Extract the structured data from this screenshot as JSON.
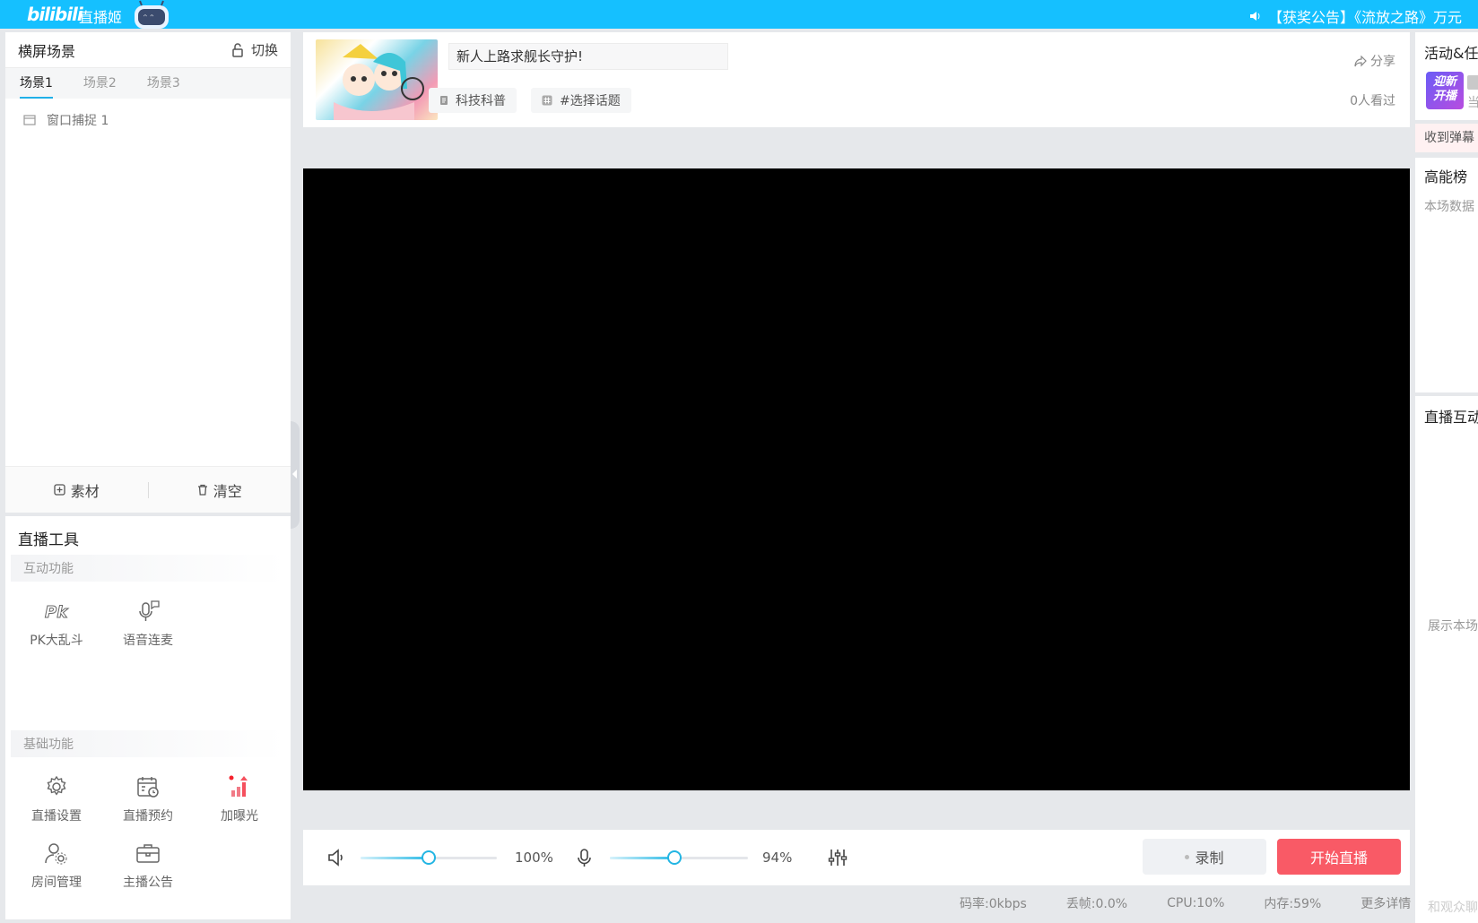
{
  "topbar": {
    "logo": "bilibili",
    "app_name": "直播姬",
    "notice": "【获奖公告】《流放之路》万元"
  },
  "scene_panel": {
    "title": "横屏场景",
    "switch_label": "切换",
    "tabs": [
      {
        "label": "场景1",
        "active": true
      },
      {
        "label": "场景2",
        "active": false
      },
      {
        "label": "场景3",
        "active": false
      }
    ],
    "sources": [
      {
        "label": "窗口捕捉 1"
      }
    ],
    "footer": {
      "add_label": "素材",
      "clear_label": "清空"
    }
  },
  "tools_panel": {
    "title": "直播工具",
    "interactive_section": "互动功能",
    "interactive_tools": [
      {
        "label": "PK大乱斗",
        "icon": "pk-icon"
      },
      {
        "label": "语音连麦",
        "icon": "mic-chat-icon"
      }
    ],
    "basic_section": "基础功能",
    "basic_tools": [
      {
        "label": "直播设置",
        "icon": "gear-icon"
      },
      {
        "label": "直播预约",
        "icon": "calendar-clock-icon"
      },
      {
        "label": "加曝光",
        "icon": "bar-chart-up-icon"
      },
      {
        "label": "房间管理",
        "icon": "user-gear-icon"
      },
      {
        "label": "主播公告",
        "icon": "briefcase-icon"
      }
    ]
  },
  "info_bar": {
    "stream_title": "新人上路求舰长守护!",
    "category": "科技科普",
    "topic": "#选择话题",
    "share_label": "分享",
    "viewers": "0人看过"
  },
  "controls": {
    "speaker_volume": 0.5,
    "speaker_volume_text": "100%",
    "mic_volume": 0.47,
    "mic_volume_text": "94%",
    "record_label": "录制",
    "start_label": "开始直播"
  },
  "status_bar": {
    "bitrate": "码率:0kbps",
    "dropped": "丢帧:0.0%",
    "cpu": "CPU:10%",
    "memory": "内存:59%",
    "more": "更多详情"
  },
  "right_panel": {
    "activity_title": "活动&任",
    "badge_line1": "迎新",
    "badge_line2": "开播",
    "badge_sub": "当",
    "danmu_label": "收到弹幕",
    "rank_title": "高能榜",
    "rank_sub": "本场数据",
    "interact_title": "直播互动",
    "interact_desc": "展示本场",
    "bottom_hint": "和观众聊"
  },
  "colors": {
    "topbar": "#15c0ff",
    "accent": "#23b5e3",
    "start_button": "#f95a66"
  }
}
